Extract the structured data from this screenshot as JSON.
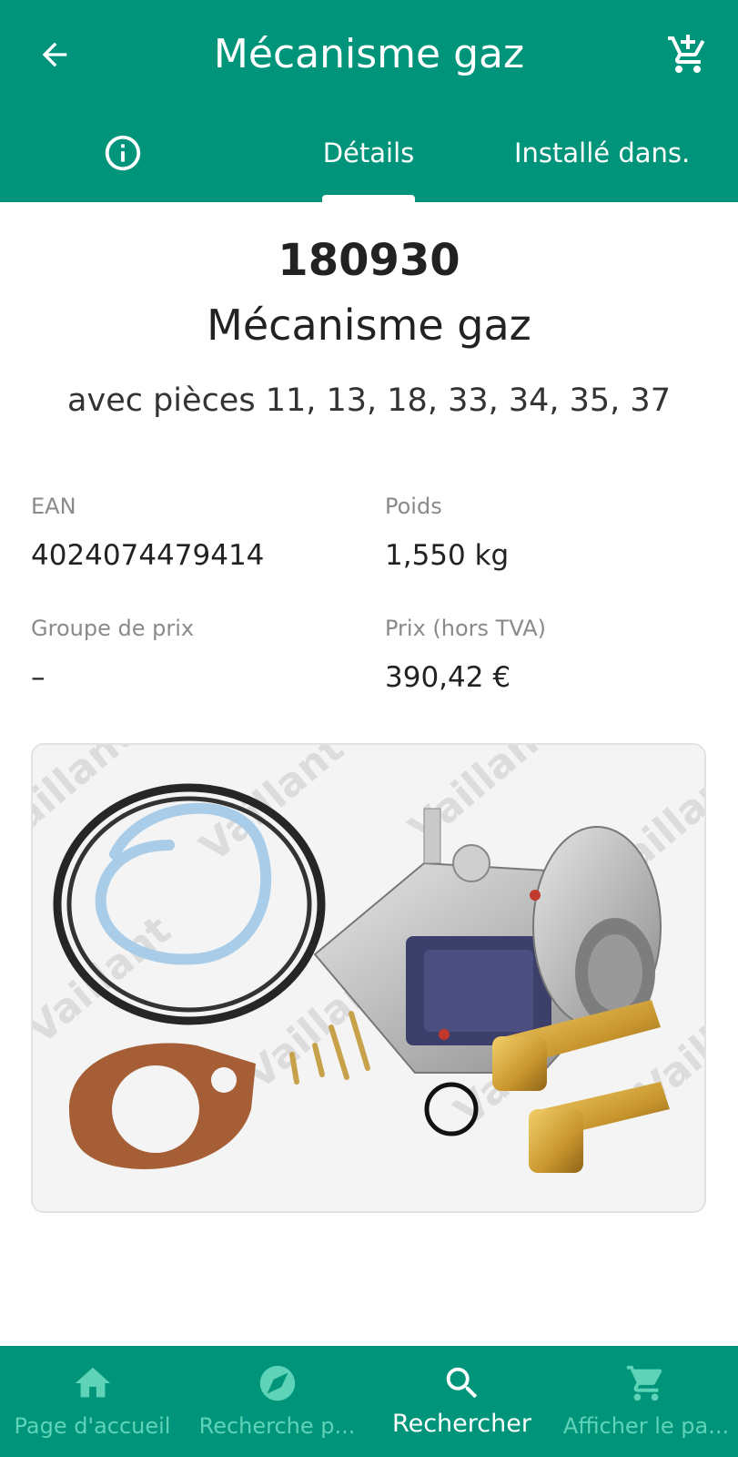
{
  "header": {
    "title": "Mécanisme gaz",
    "back_icon": "arrow-left-icon",
    "cart_icon": "cart-add-icon",
    "background_color": "#00957a"
  },
  "tabs": [
    {
      "icon": "info-icon",
      "label": ""
    },
    {
      "label": "Détails",
      "selected": true
    },
    {
      "label": "Installé dans."
    }
  ],
  "part": {
    "number": "180930",
    "name": "Mécanisme gaz",
    "description": "avec pièces 11, 13, 18, 33, 34, 35, 37"
  },
  "specs": {
    "ean_label": "EAN",
    "ean_value": "4024074479414",
    "weight_label": "Poids",
    "weight_value": "1,550 kg",
    "price_group_label": "Groupe de prix",
    "price_group_value": "–",
    "price_label": "Prix (hors TVA)",
    "price_value": "390,42 €"
  },
  "image": {
    "watermark": "Vaillant"
  },
  "bottom_nav": [
    {
      "icon": "home-icon",
      "label": "Page d'accueil"
    },
    {
      "icon": "compass-icon",
      "label": "Recherche p..."
    },
    {
      "icon": "search-icon",
      "label": "Rechercher",
      "active": true
    },
    {
      "icon": "cart-icon",
      "label": "Afficher le pa..."
    }
  ]
}
